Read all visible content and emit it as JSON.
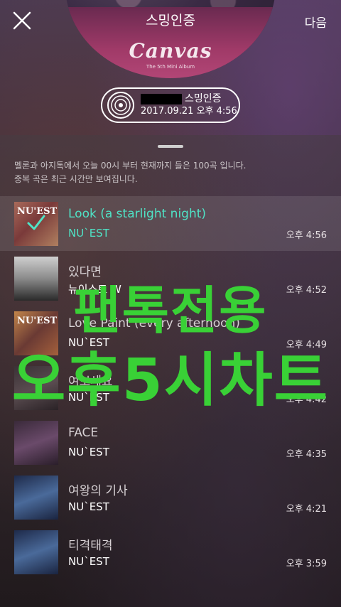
{
  "header": {
    "next_label": "다음",
    "album_overlay_title": "스밍인증",
    "album_name": "Canvas",
    "album_subtitle": "The 5th Mini Album",
    "verify_suffix": "스밍인증",
    "verify_datetime": "2017.09.21 오후 4:56"
  },
  "info": {
    "line1": "멜론과 아지톡에서 오늘 00시 부터 현재까지 들은 100곡 입니다.",
    "line2": "중복 곡은 최근 시간만 보여집니다."
  },
  "songs": [
    {
      "title": "Look (a starlight night)",
      "artist": "NU`EST",
      "time": "오후 4:56",
      "selected": true
    },
    {
      "title": "있다면",
      "artist": "뉴이스트 W",
      "time": "오후 4:52"
    },
    {
      "title": "Love Paint (every afternoon)",
      "artist": "NU`EST",
      "time": "오후 4:49"
    },
    {
      "title": "여보세요",
      "artist": "NU`EST",
      "time": "오후 4:42"
    },
    {
      "title": "FACE",
      "artist": "NU`EST",
      "time": "오후 4:35"
    },
    {
      "title": "여왕의 기사",
      "artist": "NU`EST",
      "time": "오후 4:21"
    },
    {
      "title": "티격태격",
      "artist": "NU`EST",
      "time": "오후 3:59"
    }
  ],
  "thumb_labels": {
    "nuest": "NU'EST"
  },
  "watermark": {
    "line1": "팬톡전용",
    "line2": "오후5시차트"
  },
  "colors": {
    "accent": "#4fe3c6",
    "watermark": "#39d136"
  }
}
